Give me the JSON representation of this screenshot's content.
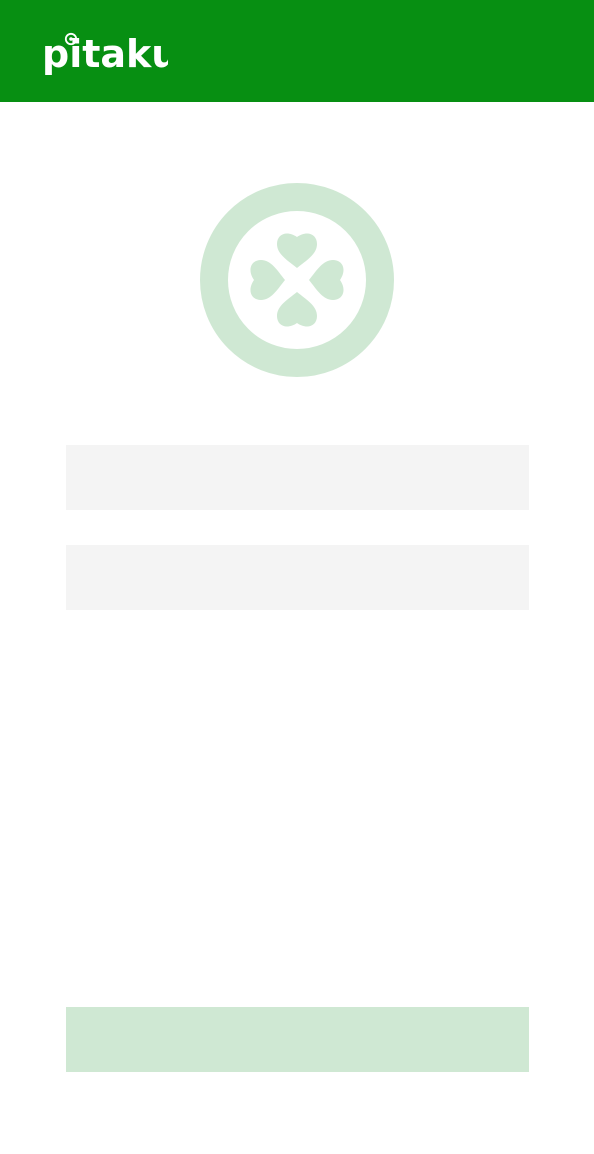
{
  "header": {
    "logo_text": "pitaku",
    "logo_icon": "clover-dot-icon",
    "background_color": "#078f12"
  },
  "avatar": {
    "icon": "clover-icon",
    "color": "#cfe8d3"
  },
  "form": {
    "field_1": {
      "value": "",
      "placeholder": ""
    },
    "field_2": {
      "value": "",
      "placeholder": ""
    },
    "submit_label": ""
  },
  "colors": {
    "field_background": "#f4f4f4",
    "button_background": "#cfe8d3"
  }
}
